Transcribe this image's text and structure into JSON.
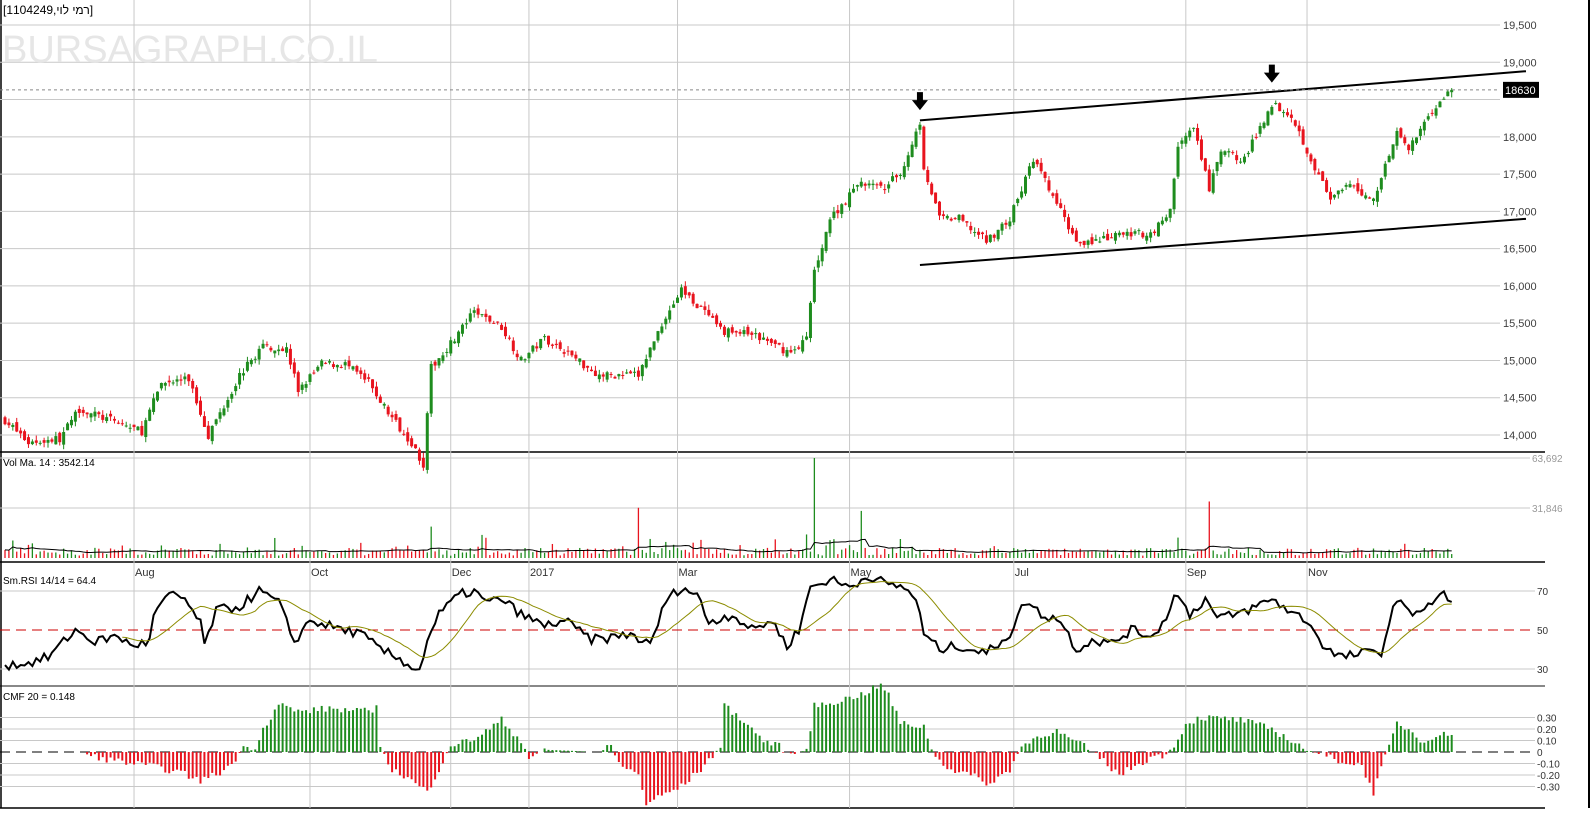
{
  "header": {
    "title": "[1104249,רמי לוי]",
    "watermark": "BURSAGRAPH.CO.IL"
  },
  "colors": {
    "up": "#1e8c1e",
    "down": "#e8141e",
    "grid": "#c8c8c8",
    "rsi_ma": "#8c8c00",
    "axis_text": "#404040"
  },
  "chart_data": [
    {
      "type": "candlestick",
      "title": "[1104249,רמי לוי]",
      "n_days": 371,
      "last_price": "18630",
      "yticks": [
        14000,
        14500,
        15000,
        15500,
        16000,
        16500,
        17000,
        17500,
        18000,
        18500,
        19000,
        19500
      ],
      "ytick_labels": [
        "14,000",
        "14,500",
        "15,000",
        "15,500",
        "16,000",
        "16,500",
        "17,000",
        "17,500",
        "18,000",
        "",
        "19,000",
        "19,500"
      ],
      "ylim": [
        13650,
        19500
      ],
      "month_labels": [
        {
          "day": 33,
          "label": "Aug"
        },
        {
          "day": 78,
          "label": "Oct"
        },
        {
          "day": 114,
          "label": "Dec"
        },
        {
          "day": 134,
          "label": "2017"
        },
        {
          "day": 172,
          "label": "Mar"
        },
        {
          "day": 216,
          "label": "May"
        },
        {
          "day": 258,
          "label": "Jul"
        },
        {
          "day": 302,
          "label": "Sep"
        },
        {
          "day": 333,
          "label": "Nov"
        }
      ],
      "close_anchors": [
        [
          0,
          14200
        ],
        [
          6,
          13900
        ],
        [
          14,
          13950
        ],
        [
          19,
          14350
        ],
        [
          24,
          14250
        ],
        [
          35,
          14050
        ],
        [
          40,
          14700
        ],
        [
          47,
          14750
        ],
        [
          52,
          14000
        ],
        [
          60,
          14800
        ],
        [
          66,
          15200
        ],
        [
          72,
          15150
        ],
        [
          75,
          14600
        ],
        [
          81,
          14950
        ],
        [
          87,
          14950
        ],
        [
          93,
          14700
        ],
        [
          98,
          14300
        ],
        [
          104,
          13900
        ],
        [
          107,
          13600
        ],
        [
          109,
          14900
        ],
        [
          115,
          15300
        ],
        [
          120,
          15650
        ],
        [
          127,
          15450
        ],
        [
          132,
          15000
        ],
        [
          138,
          15300
        ],
        [
          144,
          15100
        ],
        [
          152,
          14800
        ],
        [
          162,
          14800
        ],
        [
          168,
          15500
        ],
        [
          173,
          15950
        ],
        [
          178,
          15700
        ],
        [
          183,
          15400
        ],
        [
          191,
          15350
        ],
        [
          197,
          15200
        ],
        [
          201,
          15100
        ],
        [
          205,
          15300
        ],
        [
          207,
          16200
        ],
        [
          211,
          16900
        ],
        [
          219,
          17400
        ],
        [
          224,
          17300
        ],
        [
          229,
          17500
        ],
        [
          234,
          18200
        ],
        [
          235,
          17600
        ],
        [
          239,
          16900
        ],
        [
          244,
          16900
        ],
        [
          251,
          16600
        ],
        [
          257,
          16900
        ],
        [
          263,
          17700
        ],
        [
          269,
          17100
        ],
        [
          274,
          16600
        ],
        [
          280,
          16600
        ],
        [
          286,
          16700
        ],
        [
          293,
          16700
        ],
        [
          298,
          17000
        ],
        [
          300,
          17900
        ],
        [
          304,
          18100
        ],
        [
          308,
          17300
        ],
        [
          311,
          17800
        ],
        [
          317,
          17700
        ],
        [
          324,
          18450
        ],
        [
          329,
          18300
        ],
        [
          334,
          17700
        ],
        [
          339,
          17150
        ],
        [
          344,
          17350
        ],
        [
          350,
          17150
        ],
        [
          356,
          18100
        ],
        [
          359,
          17800
        ],
        [
          364,
          18300
        ],
        [
          370,
          18630
        ]
      ],
      "trendlines": [
        {
          "name": "resistance",
          "from": [
            234,
            18220
          ],
          "to": [
            389,
            18880
          ]
        },
        {
          "name": "support",
          "from": [
            234,
            16280
          ],
          "to": [
            389,
            16900
          ]
        }
      ],
      "arrows": [
        {
          "day": 234,
          "price": 18250
        },
        {
          "day": 324,
          "price": 18620
        }
      ]
    },
    {
      "type": "bar",
      "title": "Vol Ma. 14 : 3542.14",
      "yticks": [
        31846,
        63692
      ],
      "ytick_labels": [
        "31,846",
        "63,692"
      ],
      "ylim": [
        0,
        63692
      ],
      "spikes": [
        [
          207,
          63692
        ],
        [
          219,
          30000
        ],
        [
          308,
          36000
        ],
        [
          162,
          32000
        ],
        [
          109,
          20000
        ],
        [
          55,
          9000
        ],
        [
          40,
          8000
        ],
        [
          205,
          15000
        ],
        [
          212,
          12000
        ],
        [
          300,
          13000
        ]
      ]
    },
    {
      "type": "line",
      "title": "Sm.RSI 14/14 = 64.4",
      "yticks": [
        30,
        50,
        70
      ],
      "ytick_labels": [
        "30",
        "50",
        "70"
      ],
      "ylim": [
        25,
        82
      ],
      "anchors": [
        [
          0,
          32
        ],
        [
          6,
          33
        ],
        [
          11,
          36
        ],
        [
          18,
          50
        ],
        [
          23,
          44
        ],
        [
          29,
          47
        ],
        [
          32,
          42
        ],
        [
          37,
          44
        ],
        [
          38,
          58
        ],
        [
          42,
          68
        ],
        [
          46,
          66
        ],
        [
          50,
          53
        ],
        [
          51,
          42
        ],
        [
          54,
          60
        ],
        [
          60,
          62
        ],
        [
          65,
          70
        ],
        [
          70,
          64
        ],
        [
          74,
          44
        ],
        [
          78,
          55
        ],
        [
          83,
          52
        ],
        [
          87,
          50
        ],
        [
          91,
          48
        ],
        [
          96,
          40
        ],
        [
          101,
          35
        ],
        [
          106,
          29
        ],
        [
          108,
          45
        ],
        [
          111,
          58
        ],
        [
          116,
          68
        ],
        [
          120,
          70
        ],
        [
          123,
          64
        ],
        [
          127,
          66
        ],
        [
          132,
          58
        ],
        [
          138,
          52
        ],
        [
          143,
          55
        ],
        [
          150,
          45
        ],
        [
          155,
          46
        ],
        [
          160,
          48
        ],
        [
          165,
          42
        ],
        [
          169,
          65
        ],
        [
          173,
          72
        ],
        [
          177,
          68
        ],
        [
          180,
          54
        ],
        [
          186,
          58
        ],
        [
          191,
          50
        ],
        [
          196,
          55
        ],
        [
          200,
          42
        ],
        [
          203,
          50
        ],
        [
          206,
          72
        ],
        [
          211,
          76
        ],
        [
          216,
          72
        ],
        [
          221,
          78
        ],
        [
          226,
          73
        ],
        [
          230,
          72
        ],
        [
          233,
          66
        ],
        [
          235,
          48
        ],
        [
          239,
          40
        ],
        [
          244,
          42
        ],
        [
          251,
          38
        ],
        [
          255,
          45
        ],
        [
          257,
          48
        ],
        [
          261,
          65
        ],
        [
          265,
          58
        ],
        [
          270,
          55
        ],
        [
          274,
          40
        ],
        [
          278,
          45
        ],
        [
          283,
          43
        ],
        [
          288,
          50
        ],
        [
          293,
          47
        ],
        [
          297,
          55
        ],
        [
          299,
          70
        ],
        [
          303,
          58
        ],
        [
          307,
          66
        ],
        [
          310,
          56
        ],
        [
          315,
          58
        ],
        [
          320,
          62
        ],
        [
          324,
          66
        ],
        [
          329,
          59
        ],
        [
          333,
          55
        ],
        [
          338,
          40
        ],
        [
          342,
          36
        ],
        [
          347,
          38
        ],
        [
          352,
          39
        ],
        [
          356,
          67
        ],
        [
          359,
          58
        ],
        [
          364,
          63
        ],
        [
          368,
          68
        ],
        [
          370,
          64.4
        ]
      ]
    },
    {
      "type": "bar",
      "title": "CMF 20 = 0.148",
      "yticks": [
        -0.3,
        -0.2,
        -0.1,
        0,
        0.1,
        0.2,
        0.3
      ],
      "ytick_labels": [
        "-0.30",
        "-0.20",
        "-0.10",
        "0",
        "0.10",
        "0.20",
        "0.30"
      ],
      "anchors": [
        [
          0,
          0
        ],
        [
          20,
          0
        ],
        [
          21,
          -0.03
        ],
        [
          24,
          -0.05
        ],
        [
          29,
          -0.08
        ],
        [
          37,
          -0.12
        ],
        [
          45,
          -0.18
        ],
        [
          50,
          -0.25
        ],
        [
          55,
          -0.18
        ],
        [
          59,
          -0.08
        ],
        [
          60,
          0.02
        ],
        [
          64,
          0.05
        ],
        [
          66,
          0.2
        ],
        [
          70,
          0.42
        ],
        [
          75,
          0.35
        ],
        [
          83,
          0.38
        ],
        [
          91,
          0.35
        ],
        [
          95,
          0.38
        ],
        [
          96,
          0.05
        ],
        [
          99,
          -0.15
        ],
        [
          104,
          -0.25
        ],
        [
          108,
          -0.35
        ],
        [
          112,
          -0.08
        ],
        [
          114,
          0.06
        ],
        [
          119,
          0.1
        ],
        [
          124,
          0.2
        ],
        [
          127,
          0.28
        ],
        [
          129,
          0.2
        ],
        [
          132,
          0.1
        ],
        [
          134,
          -0.05
        ],
        [
          138,
          0.02
        ],
        [
          152,
          0
        ],
        [
          155,
          0.05
        ],
        [
          157,
          -0.1
        ],
        [
          162,
          -0.2
        ],
        [
          164,
          -0.45
        ],
        [
          168,
          -0.38
        ],
        [
          173,
          -0.3
        ],
        [
          178,
          -0.15
        ],
        [
          183,
          0.05
        ],
        [
          184,
          0.4
        ],
        [
          188,
          0.3
        ],
        [
          191,
          0.2
        ],
        [
          194,
          0.1
        ],
        [
          198,
          0.05
        ],
        [
          201,
          -0.03
        ],
        [
          205,
          0.02
        ],
        [
          207,
          0.4
        ],
        [
          214,
          0.45
        ],
        [
          219,
          0.5
        ],
        [
          224,
          0.58
        ],
        [
          226,
          0.5
        ],
        [
          229,
          0.25
        ],
        [
          235,
          0.22
        ],
        [
          238,
          -0.05
        ],
        [
          242,
          -0.15
        ],
        [
          247,
          -0.2
        ],
        [
          252,
          -0.28
        ],
        [
          257,
          -0.15
        ],
        [
          260,
          0.05
        ],
        [
          265,
          0.15
        ],
        [
          269,
          0.18
        ],
        [
          273,
          0.1
        ],
        [
          276,
          0.05
        ],
        [
          280,
          -0.05
        ],
        [
          285,
          -0.2
        ],
        [
          289,
          -0.12
        ],
        [
          293,
          -0.05
        ],
        [
          297,
          -0.02
        ],
        [
          300,
          0.1
        ],
        [
          302,
          0.25
        ],
        [
          306,
          0.3
        ],
        [
          316,
          0.28
        ],
        [
          324,
          0.2
        ],
        [
          329,
          0.1
        ],
        [
          333,
          0.02
        ],
        [
          337,
          -0.03
        ],
        [
          342,
          -0.08
        ],
        [
          347,
          -0.12
        ],
        [
          350,
          -0.35
        ],
        [
          354,
          0.05
        ],
        [
          356,
          0.25
        ],
        [
          359,
          0.2
        ],
        [
          362,
          0.1
        ],
        [
          367,
          0.15
        ],
        [
          370,
          0.15
        ]
      ]
    }
  ]
}
